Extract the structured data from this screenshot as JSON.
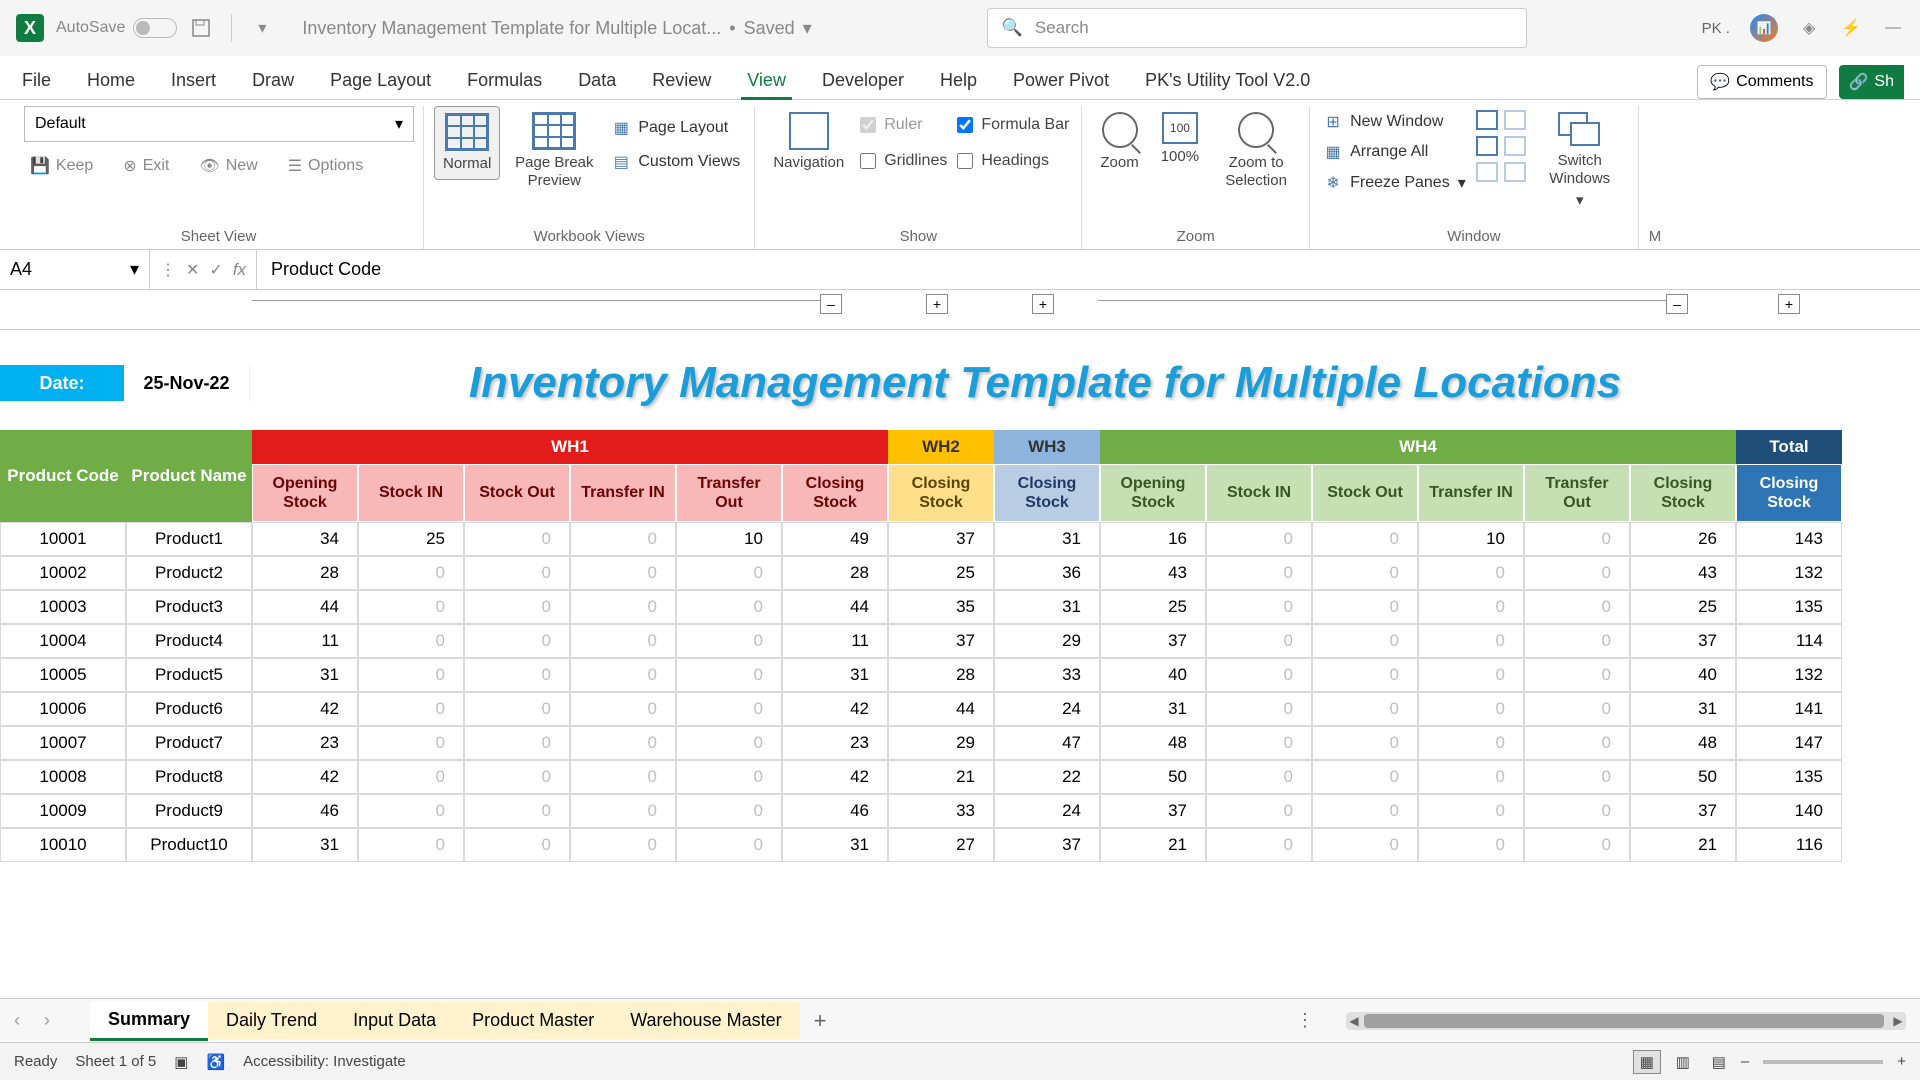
{
  "title_bar": {
    "autosave": "AutoSave",
    "autosave_state": "On",
    "doc_name": "Inventory Management Template for Multiple Locat...",
    "saved": "Saved",
    "search_placeholder": "Search",
    "user": "PK ."
  },
  "tabs": {
    "file": "File",
    "home": "Home",
    "insert": "Insert",
    "draw": "Draw",
    "pagelayout": "Page Layout",
    "formulas": "Formulas",
    "data": "Data",
    "review": "Review",
    "view": "View",
    "developer": "Developer",
    "help": "Help",
    "powerpivot": "Power Pivot",
    "pktool": "PK's Utility Tool V2.0",
    "comments": "Comments",
    "share": "Sh"
  },
  "ribbon": {
    "sheetview_default": "Default",
    "sheetview_keep": "Keep",
    "sheetview_exit": "Exit",
    "sheetview_new": "New",
    "sheetview_options": "Options",
    "sheetview_label": "Sheet View",
    "wb_normal": "Normal",
    "wb_pbp": "Page Break Preview",
    "wb_pagelayout": "Page Layout",
    "wb_custom": "Custom Views",
    "wb_label": "Workbook Views",
    "nav": "Navigation",
    "show_ruler": "Ruler",
    "show_formula": "Formula Bar",
    "show_grid": "Gridlines",
    "show_headings": "Headings",
    "show_label": "Show",
    "zoom": "Zoom",
    "zoom100": "100%",
    "zoom_sel": "Zoom to Selection",
    "zoom_label": "Zoom",
    "win_new": "New Window",
    "win_arrange": "Arrange All",
    "win_freeze": "Freeze Panes",
    "win_label": "Window",
    "win_switch": "Switch Windows"
  },
  "namebox": "A4",
  "formula": "Product Code",
  "sheet": {
    "date_label": "Date:",
    "date_value": "25-Nov-22",
    "title": "Inventory Management Template for Multiple Locations",
    "groups": [
      "WH1",
      "WH2",
      "WH3",
      "WH4",
      "Total"
    ],
    "headers_left": [
      "Product Code",
      "Product Name"
    ],
    "headers_wh": [
      "Opening Stock",
      "Stock IN",
      "Stock Out",
      "Transfer IN",
      "Transfer Out",
      "Closing Stock"
    ],
    "headers_closing": "Closing Stock",
    "rows": [
      {
        "code": "10001",
        "name": "Product1",
        "wh1": [
          34,
          25,
          0,
          0,
          10,
          49
        ],
        "wh2": 37,
        "wh3": 31,
        "wh4": [
          16,
          0,
          0,
          10,
          0,
          26
        ],
        "total": 143
      },
      {
        "code": "10002",
        "name": "Product2",
        "wh1": [
          28,
          0,
          0,
          0,
          0,
          28
        ],
        "wh2": 25,
        "wh3": 36,
        "wh4": [
          43,
          0,
          0,
          0,
          0,
          43
        ],
        "total": 132
      },
      {
        "code": "10003",
        "name": "Product3",
        "wh1": [
          44,
          0,
          0,
          0,
          0,
          44
        ],
        "wh2": 35,
        "wh3": 31,
        "wh4": [
          25,
          0,
          0,
          0,
          0,
          25
        ],
        "total": 135
      },
      {
        "code": "10004",
        "name": "Product4",
        "wh1": [
          11,
          0,
          0,
          0,
          0,
          11
        ],
        "wh2": 37,
        "wh3": 29,
        "wh4": [
          37,
          0,
          0,
          0,
          0,
          37
        ],
        "total": 114
      },
      {
        "code": "10005",
        "name": "Product5",
        "wh1": [
          31,
          0,
          0,
          0,
          0,
          31
        ],
        "wh2": 28,
        "wh3": 33,
        "wh4": [
          40,
          0,
          0,
          0,
          0,
          40
        ],
        "total": 132
      },
      {
        "code": "10006",
        "name": "Product6",
        "wh1": [
          42,
          0,
          0,
          0,
          0,
          42
        ],
        "wh2": 44,
        "wh3": 24,
        "wh4": [
          31,
          0,
          0,
          0,
          0,
          31
        ],
        "total": 141
      },
      {
        "code": "10007",
        "name": "Product7",
        "wh1": [
          23,
          0,
          0,
          0,
          0,
          23
        ],
        "wh2": 29,
        "wh3": 47,
        "wh4": [
          48,
          0,
          0,
          0,
          0,
          48
        ],
        "total": 147
      },
      {
        "code": "10008",
        "name": "Product8",
        "wh1": [
          42,
          0,
          0,
          0,
          0,
          42
        ],
        "wh2": 21,
        "wh3": 22,
        "wh4": [
          50,
          0,
          0,
          0,
          0,
          50
        ],
        "total": 135
      },
      {
        "code": "10009",
        "name": "Product9",
        "wh1": [
          46,
          0,
          0,
          0,
          0,
          46
        ],
        "wh2": 33,
        "wh3": 24,
        "wh4": [
          37,
          0,
          0,
          0,
          0,
          37
        ],
        "total": 140
      },
      {
        "code": "10010",
        "name": "Product10",
        "wh1": [
          31,
          0,
          0,
          0,
          0,
          31
        ],
        "wh2": 27,
        "wh3": 37,
        "wh4": [
          21,
          0,
          0,
          0,
          0,
          21
        ],
        "total": 116
      }
    ]
  },
  "sheet_tabs": [
    "Summary",
    "Daily Trend",
    "Input Data",
    "Product Master",
    "Warehouse Master"
  ],
  "status": {
    "ready": "Ready",
    "sheet": "Sheet 1 of 5",
    "acc": "Accessibility: Investigate"
  }
}
